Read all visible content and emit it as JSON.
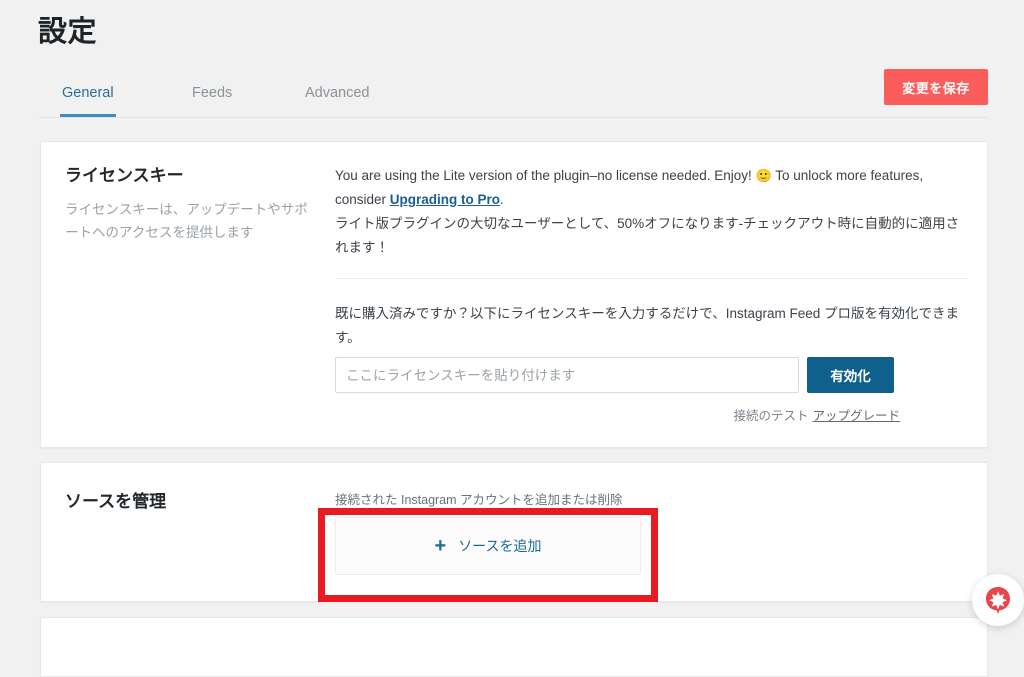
{
  "header": {
    "title": "設定",
    "save_label": "変更を保存",
    "save_color": "#fb5d5d",
    "tabs": [
      {
        "label": "General",
        "active": true
      },
      {
        "label": "Feeds",
        "active": false
      },
      {
        "label": "Advanced",
        "active": false
      }
    ],
    "active_tab_color": "#2c6c9b",
    "tab_underline_color": "#3c8dbc"
  },
  "license_section": {
    "heading": "ライセンスキー",
    "description": "ライセンスキーは、アップデートやサポートへのアクセスを提供します",
    "lite_note_part1": "You are using the Lite version of the plugin–no license needed. Enjoy! ",
    "lite_note_emoji": "🙂",
    "lite_note_part2": " To unlock more features, consider ",
    "upgrade_link": "Upgrading to Pro",
    "lite_note_part3": ".",
    "discount_note": "ライト版プラグインの大切なユーザーとして、50%オフになります-チェックアウト時に自動的に適用されます！",
    "purchase_note": "既に購入済みですか？以下にライセンスキーを入力するだけで、Instagram Feed プロ版を有効化できます。",
    "input_placeholder": "ここにライセンスキーを貼り付けます",
    "input_value": "",
    "activate_label": "有効化",
    "activate_color": "#10608e",
    "test_connection_label": "接続のテスト",
    "upgrade_label": "アップグレード"
  },
  "sources_section": {
    "heading": "ソースを管理",
    "description": "接続された Instagram アカウントを追加または削除",
    "add_source_label": "ソースを追加",
    "plus_icon": "+"
  },
  "annotation": {
    "color": "#e81b23",
    "target": "add-source-button"
  },
  "support_widget": {
    "icon": "support-star-icon",
    "color": "#e8464a"
  }
}
